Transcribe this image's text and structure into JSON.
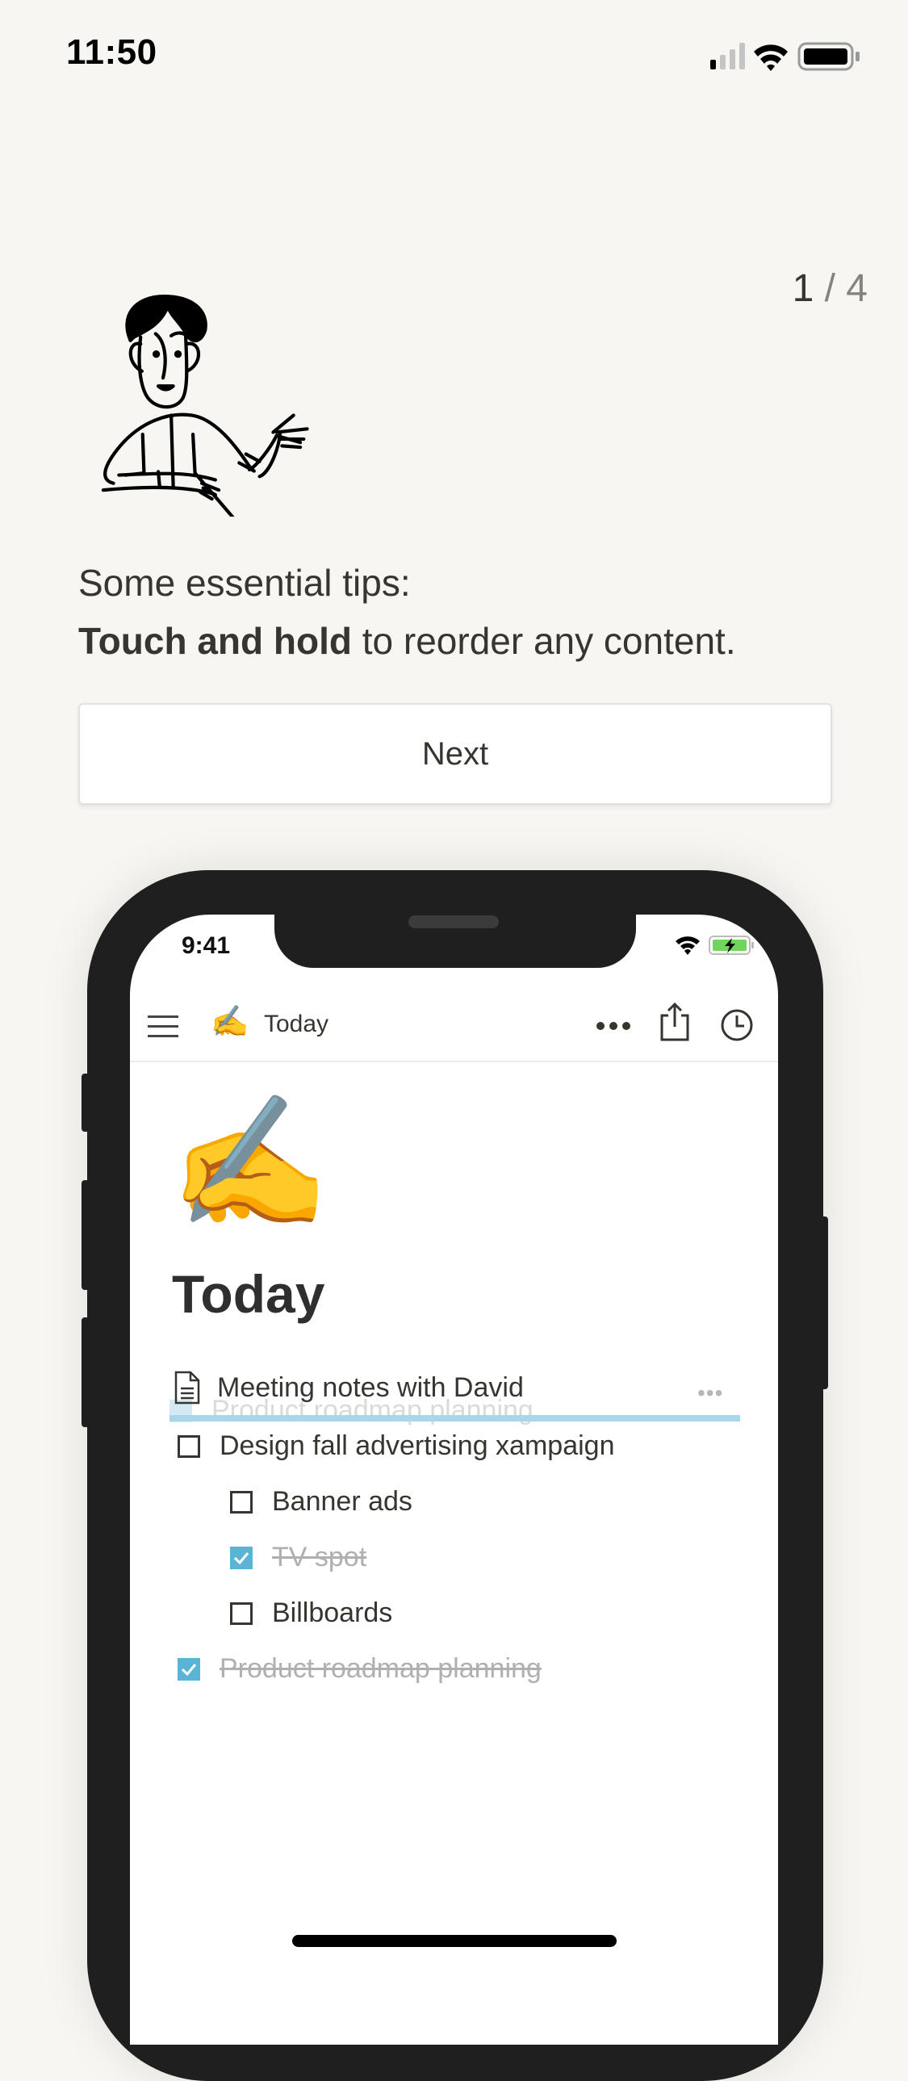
{
  "status_bar": {
    "time": "11:50",
    "icons": [
      "cellular-signal-icon",
      "wifi-icon",
      "battery-icon"
    ]
  },
  "pager": {
    "current": "1",
    "separator": " / ",
    "total": "4"
  },
  "illustration": {
    "icon": "person-presenting-illustration"
  },
  "tips": {
    "intro": "Some essential tips:",
    "tip_bold": "Touch and hold",
    "tip_rest": " to reorder any content."
  },
  "next_button": {
    "label": "Next"
  },
  "device_preview": {
    "status_time": "9:41",
    "status_icons": [
      "wifi-icon",
      "battery-charging-icon"
    ],
    "nav": {
      "menu_icon": "hamburger-menu-icon",
      "page_emoji": "✍️",
      "title": "Today",
      "actions": [
        "more-icon",
        "share-icon",
        "history-clock-icon"
      ]
    },
    "page": {
      "emoji": "✍️",
      "title": "Today",
      "dragged_item": {
        "type": "page",
        "icon": "document-icon",
        "label": "Meeting notes with David",
        "handle": "•••"
      },
      "ghost_item": {
        "label": "Product roadmap planning",
        "checked": true
      },
      "items": [
        {
          "label": "Design fall advertising xampaign",
          "checked": false,
          "indent": 0
        },
        {
          "label": "Banner ads",
          "checked": false,
          "indent": 1
        },
        {
          "label": "TV spot",
          "checked": true,
          "indent": 1
        },
        {
          "label": "Billboards",
          "checked": false,
          "indent": 1
        },
        {
          "label": "Product roadmap planning",
          "checked": true,
          "indent": 0
        }
      ]
    },
    "accent_color": "#5ab4d6"
  }
}
